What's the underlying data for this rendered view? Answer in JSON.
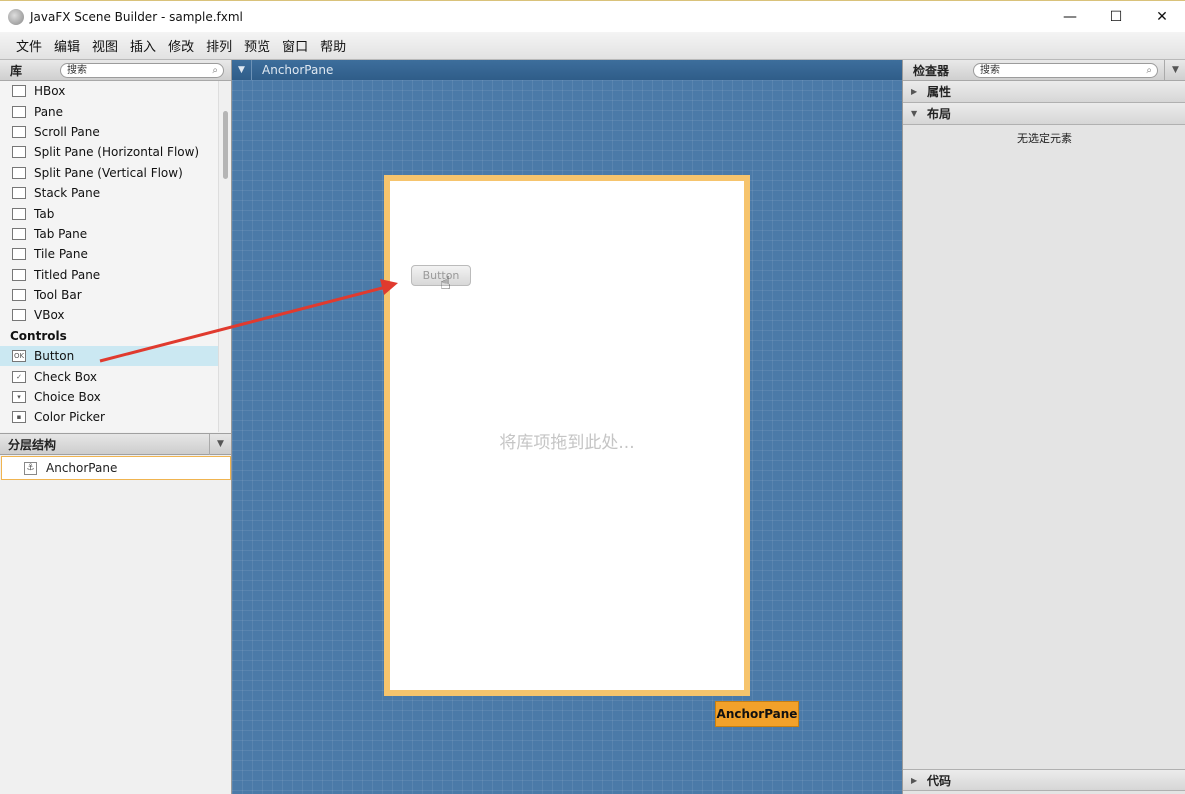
{
  "window": {
    "title": "JavaFX Scene Builder - sample.fxml",
    "minimize": "—",
    "maximize": "☐",
    "close": "✕"
  },
  "menu": [
    "文件",
    "编辑",
    "视图",
    "插入",
    "修改",
    "排列",
    "预览",
    "窗口",
    "帮助"
  ],
  "library": {
    "title": "库",
    "search_placeholder": "搜索",
    "items": [
      {
        "label": "HBox",
        "icon": "hbox-icon"
      },
      {
        "label": "Pane",
        "icon": "pane-icon"
      },
      {
        "label": "Scroll Pane",
        "icon": "scroll-pane-icon"
      },
      {
        "label": "Split Pane (Horizontal Flow)",
        "icon": "split-pane-h-icon"
      },
      {
        "label": "Split Pane (Vertical Flow)",
        "icon": "split-pane-v-icon"
      },
      {
        "label": "Stack Pane",
        "icon": "stack-pane-icon"
      },
      {
        "label": "Tab",
        "icon": "tab-icon"
      },
      {
        "label": "Tab Pane",
        "icon": "tab-pane-icon"
      },
      {
        "label": "Tile Pane",
        "icon": "tile-pane-icon"
      },
      {
        "label": "Titled Pane",
        "icon": "titled-pane-icon"
      },
      {
        "label": "Tool Bar",
        "icon": "tool-bar-icon"
      },
      {
        "label": "VBox",
        "icon": "vbox-icon"
      }
    ],
    "controls_section": "Controls",
    "controls": [
      {
        "label": "Button",
        "icon": "button-icon",
        "glyph": "OK"
      },
      {
        "label": "Check Box",
        "icon": "checkbox-icon",
        "glyph": "✓"
      },
      {
        "label": "Choice Box",
        "icon": "choice-box-icon",
        "glyph": "▾"
      },
      {
        "label": "Color Picker",
        "icon": "color-picker-icon",
        "glyph": "▪"
      }
    ]
  },
  "hierarchy": {
    "title": "分层结构",
    "root": "AnchorPane"
  },
  "canvas": {
    "breadcrumb": "AnchorPane",
    "drop_hint": "将库项拖到此处...",
    "ghost_button": "Button",
    "selection_tag": "AnchorPane"
  },
  "inspector": {
    "title": "检查器",
    "search_placeholder": "搜索",
    "sections": [
      "属性",
      "布局",
      "代码"
    ],
    "no_selection": "无选定元素"
  },
  "colors": {
    "canvas_bg": "#4b7aa8",
    "selection_border": "#f6c46d",
    "selection_tag": "#f2a12a",
    "selected_row": "#cbe8f2",
    "drag_arrow": "#e03a2e"
  }
}
